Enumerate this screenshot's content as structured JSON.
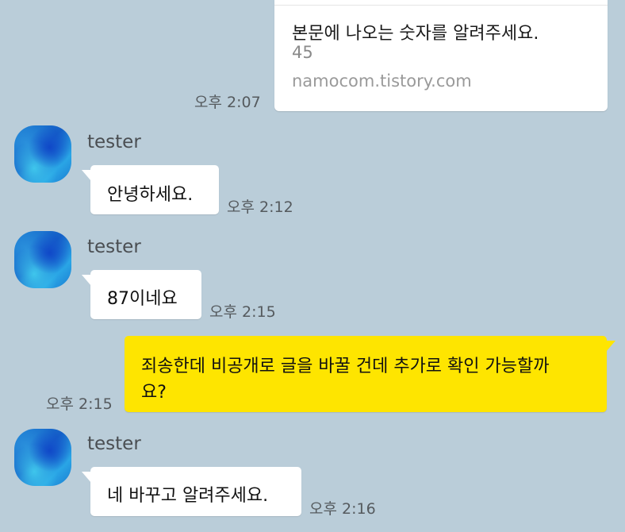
{
  "link_card": {
    "title": "본문에 나오는 숫자를 알려주세요.",
    "subtitle": "45",
    "domain": "namocom.tistory.com",
    "time": "오후 2:07"
  },
  "messages": [
    {
      "sender": "tester",
      "text": "안녕하세요.",
      "time": "오후 2:12",
      "avatar_icon": "profile-avatar"
    },
    {
      "sender": "tester",
      "text": "87이네요",
      "time": "오후 2:15",
      "avatar_icon": "profile-avatar"
    },
    {
      "sender": "me",
      "lines": [
        "죄송한데 비공개로 글을 바꿀 건데 추가로 확인 가능할까",
        "요?"
      ],
      "time": "오후 2:15"
    },
    {
      "sender": "tester",
      "text": "네 바꾸고 알려주세요.",
      "time": "오후 2:16",
      "avatar_icon": "profile-avatar"
    }
  ],
  "colors": {
    "background": "#bacdd9",
    "my_bubble": "#fee500",
    "other_bubble": "#ffffff"
  }
}
